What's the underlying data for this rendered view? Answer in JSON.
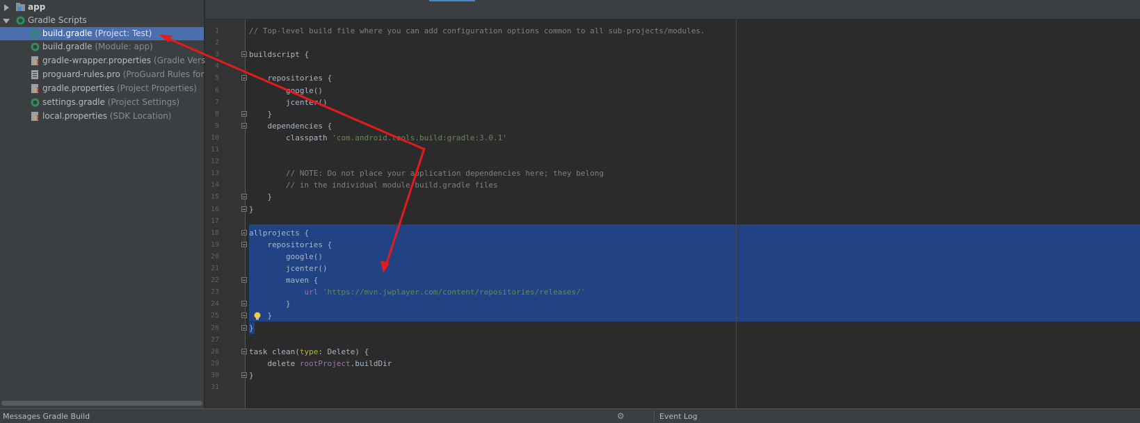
{
  "tree": {
    "items": [
      {
        "label": "app",
        "hint": ""
      },
      {
        "label": "Gradle Scripts",
        "hint": ""
      },
      {
        "label": "build.gradle",
        "hint": " (Project: Test)"
      },
      {
        "label": "build.gradle",
        "hint": " (Module: app)"
      },
      {
        "label": "gradle-wrapper.properties",
        "hint": " (Gradle Version)"
      },
      {
        "label": "proguard-rules.pro",
        "hint": " (ProGuard Rules for app)"
      },
      {
        "label": "gradle.properties",
        "hint": " (Project Properties)"
      },
      {
        "label": "settings.gradle",
        "hint": " (Project Settings)"
      },
      {
        "label": "local.properties",
        "hint": " (SDK Location)"
      }
    ]
  },
  "editor": {
    "line_numbers": [
      "1",
      "2",
      "3",
      "4",
      "5",
      "6",
      "7",
      "8",
      "9",
      "10",
      "11",
      "12",
      "13",
      "14",
      "15",
      "16",
      "17",
      "18",
      "19",
      "20",
      "21",
      "22",
      "23",
      "24",
      "25",
      "26",
      "27",
      "28",
      "29",
      "30",
      "31"
    ],
    "lines": [
      [
        {
          "t": "// Top-level build file where you can add configuration options common to all sub-projects/modules.",
          "c": "comment"
        }
      ],
      [],
      [
        {
          "t": "buildscript {",
          "c": ""
        }
      ],
      [],
      [
        {
          "t": "    repositories {",
          "c": ""
        }
      ],
      [
        {
          "t": "        google()",
          "c": ""
        }
      ],
      [
        {
          "t": "        jcenter()",
          "c": ""
        }
      ],
      [
        {
          "t": "    }",
          "c": ""
        }
      ],
      [
        {
          "t": "    dependencies {",
          "c": ""
        }
      ],
      [
        {
          "t": "        classpath ",
          "c": ""
        },
        {
          "t": "'com.android.tools.build:gradle:3.0.1'",
          "c": "str"
        }
      ],
      [],
      [],
      [
        {
          "t": "        // NOTE: Do not place your application dependencies here; they belong",
          "c": "comment"
        }
      ],
      [
        {
          "t": "        // in the individual module build.gradle files",
          "c": "comment"
        }
      ],
      [
        {
          "t": "    }",
          "c": ""
        }
      ],
      [
        {
          "t": "}",
          "c": ""
        }
      ],
      [],
      [
        {
          "t": "allprojects {",
          "c": ""
        }
      ],
      [
        {
          "t": "    repositories {",
          "c": ""
        }
      ],
      [
        {
          "t": "        google()",
          "c": ""
        }
      ],
      [
        {
          "t": "        jcenter()",
          "c": ""
        }
      ],
      [
        {
          "t": "        maven {",
          "c": ""
        }
      ],
      [
        {
          "t": "            url ",
          "c": "param"
        },
        {
          "t": "'https://mvn.jwplayer.com/content/repositories/releases/'",
          "c": "str"
        }
      ],
      [
        {
          "t": "        }",
          "c": ""
        }
      ],
      [
        {
          "t": "    }",
          "c": ""
        }
      ],
      [
        {
          "t": "}",
          "c": ""
        }
      ],
      [],
      [
        {
          "t": "task clean(",
          "c": ""
        },
        {
          "t": "type",
          "c": "named"
        },
        {
          "t": ": Delete) {",
          "c": ""
        }
      ],
      [
        {
          "t": "    delete ",
          "c": ""
        },
        {
          "t": "rootProject",
          "c": "param"
        },
        {
          "t": ".buildDir",
          "c": ""
        }
      ],
      [
        {
          "t": "}",
          "c": ""
        }
      ],
      []
    ]
  },
  "bottom": {
    "left_label": "Messages Gradle Build",
    "right_label": "Event Log",
    "gear_icon": "gear-icon"
  },
  "colors": {
    "selection": "#214283",
    "tree_selection": "#4b6eaf",
    "annotation_arrow": "#e8191b"
  }
}
